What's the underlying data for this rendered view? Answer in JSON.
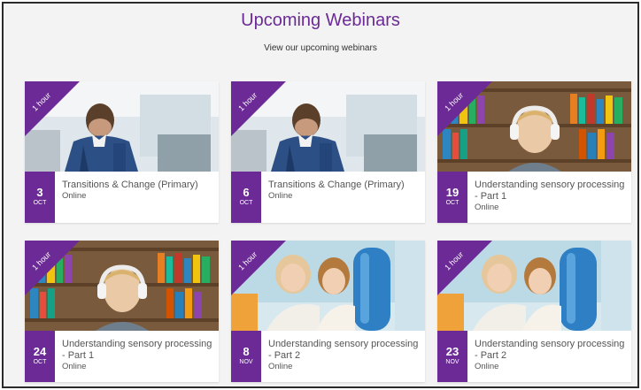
{
  "header": {
    "title": "Upcoming Webinars",
    "subtitle": "View our upcoming webinars"
  },
  "colors": {
    "accent": "#6b2a96",
    "background": "#f3f3f3"
  },
  "webinars": [
    {
      "duration": "1 hour",
      "day": "3",
      "month": "OCT",
      "title": "Transitions & Change (Primary)",
      "location": "Online",
      "image": "boy-with-backpack-photo"
    },
    {
      "duration": "1 hour",
      "day": "6",
      "month": "OCT",
      "title": "Transitions & Change (Primary)",
      "location": "Online",
      "image": "boy-with-backpack-photo"
    },
    {
      "duration": "1 hour",
      "day": "19",
      "month": "OCT",
      "title": "Understanding sensory processing - Part 1",
      "location": "Online",
      "image": "boy-with-headphones-photo"
    },
    {
      "duration": "1 hour",
      "day": "24",
      "month": "OCT",
      "title": "Understanding sensory processing - Part 1",
      "location": "Online",
      "image": "boy-with-headphones-photo"
    },
    {
      "duration": "1 hour",
      "day": "8",
      "month": "NOV",
      "title": "Understanding sensory processing - Part 2",
      "location": "Online",
      "image": "girl-with-therapist-photo"
    },
    {
      "duration": "1 hour",
      "day": "23",
      "month": "NOV",
      "title": "Understanding sensory processing - Part 2",
      "location": "Online",
      "image": "girl-with-therapist-photo"
    }
  ]
}
